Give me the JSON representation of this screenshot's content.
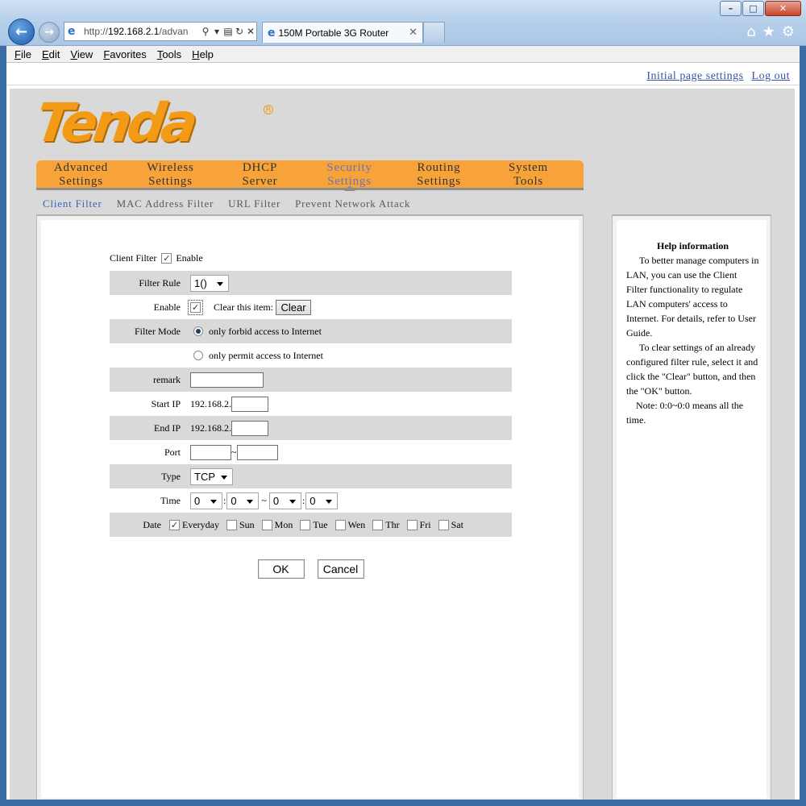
{
  "browser": {
    "address_url_prefix": "http://",
    "address_url_host": "192.168.2.1",
    "address_url_rest": "/advan",
    "tab_title": "150M Portable 3G Router",
    "menu": [
      "File",
      "Edit",
      "View",
      "Favorites",
      "Tools",
      "Help"
    ],
    "window_buttons": [
      "–",
      "□",
      "✕"
    ]
  },
  "toplinks": {
    "initial": "Initial page settings",
    "logout": "Log out"
  },
  "logo": {
    "text": "Tenda",
    "reg": "R"
  },
  "mainnav": [
    {
      "label": "Advanced\nSettings",
      "active": false
    },
    {
      "label": "Wireless\nSettings",
      "active": false
    },
    {
      "label": "DHCP\nServer",
      "active": false
    },
    {
      "label": "Security\nSettings",
      "active": true
    },
    {
      "label": "Routing\nSettings",
      "active": false
    },
    {
      "label": "System\nTools",
      "active": false
    }
  ],
  "subnav": [
    {
      "label": "Client Filter",
      "active": true
    },
    {
      "label": "MAC Address Filter",
      "active": false
    },
    {
      "label": "URL Filter",
      "active": false
    },
    {
      "label": "Prevent Network Attack",
      "active": false
    }
  ],
  "form": {
    "client_filter_label": "Client Filter",
    "client_filter_enable": "Enable",
    "client_filter_checked": true,
    "filter_rule_label": "Filter Rule",
    "filter_rule_value": "1()",
    "enable_label": "Enable",
    "enable_checked": true,
    "clear_item_label": "Clear this item:",
    "clear_button": "Clear",
    "filter_mode_label": "Filter Mode",
    "mode_forbid": "only forbid access to Internet",
    "mode_permit": "only permit access to Internet",
    "mode_selected": "forbid",
    "remark_label": "remark",
    "remark_value": "",
    "start_ip_label": "Start IP",
    "start_ip_prefix": "192.168.2.",
    "start_ip_value": "",
    "end_ip_label": "End IP",
    "end_ip_prefix": "192.168.2.",
    "end_ip_value": "",
    "port_label": "Port",
    "port_sep": "~",
    "type_label": "Type",
    "type_value": "TCP",
    "time_label": "Time",
    "time_values": [
      "0",
      "0",
      "0",
      "0"
    ],
    "time_colon": ":",
    "time_sep": "~",
    "date_label": "Date",
    "everyday": "Everyday",
    "everyday_checked": true,
    "days": [
      "Sun",
      "Mon",
      "Tue",
      "Wen",
      "Thr",
      "Fri",
      "Sat"
    ],
    "ok_button": "OK",
    "cancel_button": "Cancel"
  },
  "help": {
    "title": "Help information",
    "p1": "To better manage computers in LAN, you can use the Client Filter functionality to regulate LAN computers' access to Internet. For details, refer to User Guide.",
    "p2": "To clear settings of an already configured filter rule, select it and click the \"Clear\" button, and then the \"OK\" button.",
    "note": "Note: 0:0~0:0 means all the time."
  },
  "colors": {
    "nav_orange": "#f7a33a",
    "logo_orange": "#f39a17",
    "active_link": "#3563b8",
    "row_shade": "#d9d9d9"
  }
}
